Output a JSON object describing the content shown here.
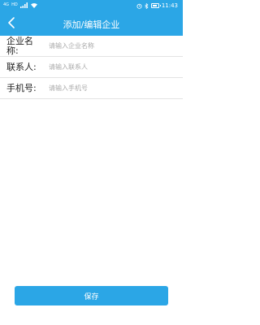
{
  "status_bar": {
    "carrier_1": "4G",
    "carrier_2": "HD",
    "time": "11:43",
    "battery_level": 0.8
  },
  "header": {
    "title": "添加/编辑企业",
    "back_icon": "chevron-left-icon",
    "background_color": "#2ba6e6"
  },
  "form": {
    "fields": [
      {
        "label": "企业名称:",
        "value": "",
        "placeholder": "请输入企业名称"
      },
      {
        "label": "联系人:",
        "value": "",
        "placeholder": "请输入联系人"
      },
      {
        "label": "手机号:",
        "value": "",
        "placeholder": "请输入手机号"
      }
    ]
  },
  "save_button": {
    "label": "保存"
  }
}
